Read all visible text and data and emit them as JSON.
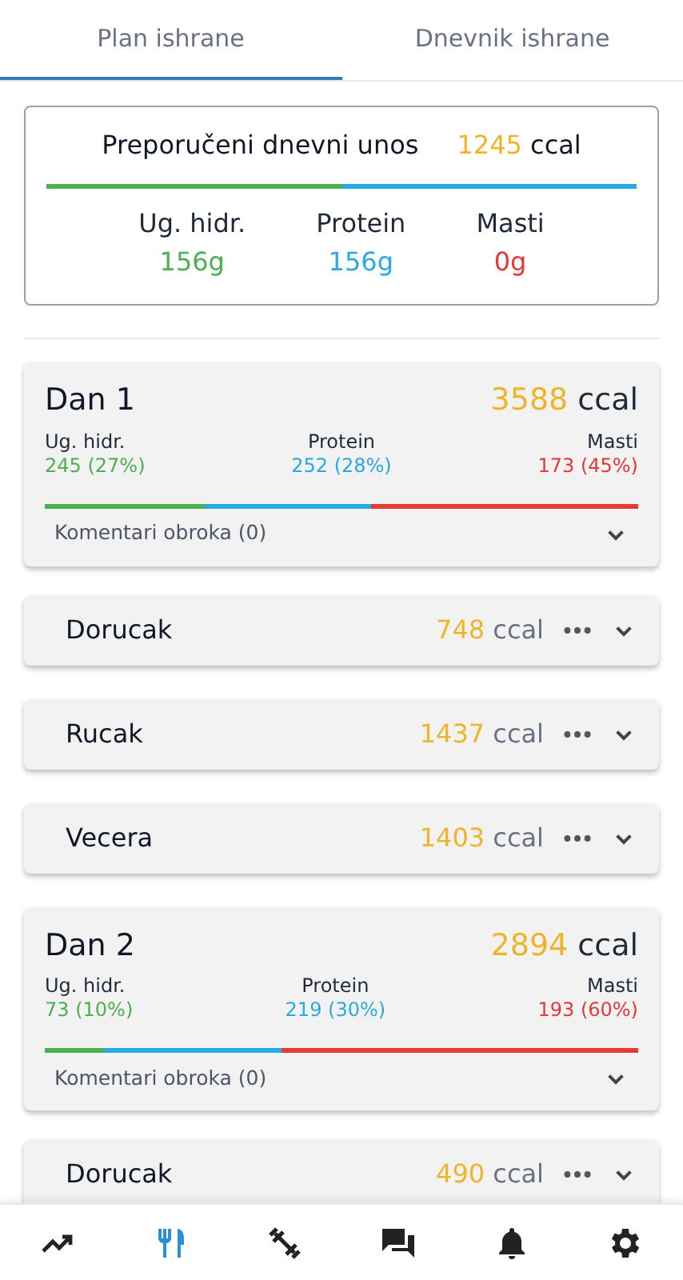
{
  "tabs": [
    {
      "label": "Plan ishrane",
      "selected": true
    },
    {
      "label": "Dnevnik ishrane",
      "selected": false
    }
  ],
  "summary": {
    "label": "Preporučeni dnevni unos",
    "calories": "1245",
    "unit": "ccal",
    "macros": [
      {
        "label": "Ug. hidr.",
        "value": "156g",
        "color": "#4caf50"
      },
      {
        "label": "Protein",
        "value": "156g",
        "color": "#29a9e1"
      },
      {
        "label": "Masti",
        "value": "0g",
        "color": "#e53935"
      }
    ]
  },
  "days": [
    {
      "title": "Dan 1",
      "calories": "3588",
      "unit": "ccal",
      "macros": [
        {
          "label": "Ug. hidr.",
          "value": "245 (27%)",
          "color": "#4caf50"
        },
        {
          "label": "Protein",
          "value": "252 (28%)",
          "color": "#29a9e1"
        },
        {
          "label": "Masti",
          "value": "173 (45%)",
          "color": "#e53935"
        }
      ],
      "comments": "Komentari obroka (0)",
      "expanded": false,
      "meals": [
        {
          "name": "Dorucak",
          "calories": "748",
          "unit": "ccal"
        },
        {
          "name": "Rucak",
          "calories": "1437",
          "unit": "ccal"
        },
        {
          "name": "Vecera",
          "calories": "1403",
          "unit": "ccal"
        }
      ]
    },
    {
      "title": "Dan 2",
      "calories": "2894",
      "unit": "ccal",
      "macros": [
        {
          "label": "Ug. hidr.",
          "value": "73 (10%)",
          "color": "#4caf50"
        },
        {
          "label": "Protein",
          "value": "219 (30%)",
          "color": "#29a9e1"
        },
        {
          "label": "Masti",
          "value": "193 (60%)",
          "color": "#e53935"
        }
      ],
      "comments": "Komentari obroka (0)",
      "expanded": false,
      "meals": [
        {
          "name": "Dorucak",
          "calories": "490",
          "unit": "ccal"
        }
      ]
    }
  ],
  "nav": [
    {
      "kind": "trend",
      "selected": false
    },
    {
      "kind": "food",
      "selected": true
    },
    {
      "kind": "fitness",
      "selected": false
    },
    {
      "kind": "chat",
      "selected": false
    },
    {
      "kind": "bell",
      "selected": false
    },
    {
      "kind": "gear",
      "selected": false
    }
  ]
}
